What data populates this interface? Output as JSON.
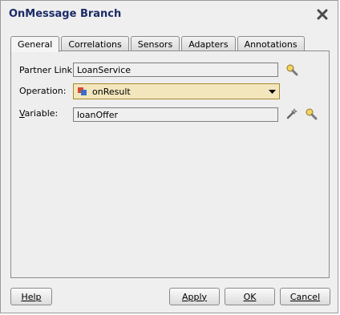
{
  "window": {
    "title": "OnMessage Branch"
  },
  "tabs": [
    {
      "label": "General",
      "active": true
    },
    {
      "label": "Correlations"
    },
    {
      "label": "Sensors"
    },
    {
      "label": "Adapters"
    },
    {
      "label": "Annotations"
    }
  ],
  "form": {
    "partner_link_label": "Partner Link:",
    "partner_link_value": "LoanService",
    "operation_label": "Operation:",
    "operation_value": "onResult",
    "variable_label": "Variable:",
    "variable_value": "loanOffer"
  },
  "buttons": {
    "help": "Help",
    "apply": "Apply",
    "ok": "OK",
    "cancel": "Cancel"
  },
  "icons": {
    "close": "close-icon",
    "flashlight": "flashlight-icon",
    "operation": "operation-icon",
    "dropdown": "chevron-down-icon",
    "create_variable": "wand-icon"
  },
  "colors": {
    "title": "#1b2b66",
    "operation_bg": "#f3e6bd"
  }
}
